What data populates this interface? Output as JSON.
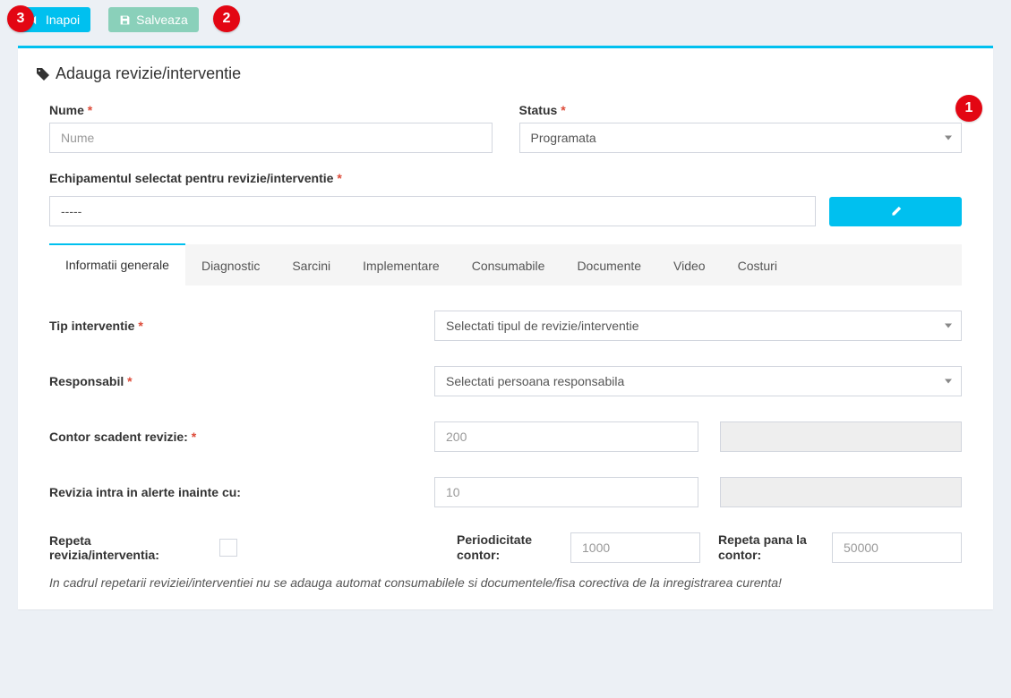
{
  "toolbar": {
    "back_label": "Inapoi",
    "save_label": "Salveaza"
  },
  "panel": {
    "title": "Adauga revizie/interventie"
  },
  "fields": {
    "name_label": "Nume",
    "name_placeholder": "Nume",
    "status_label": "Status",
    "status_value": "Programata",
    "equipment_label": "Echipamentul selectat pentru revizie/interventie",
    "equipment_value": "-----"
  },
  "tabs": [
    "Informatii generale",
    "Diagnostic",
    "Sarcini",
    "Implementare",
    "Consumabile",
    "Documente",
    "Video",
    "Costuri"
  ],
  "general": {
    "type_label": "Tip interventie",
    "type_placeholder": "Selectati tipul de revizie/interventie",
    "responsible_label": "Responsabil",
    "responsible_placeholder": "Selectati persoana responsabila",
    "counter_due_label": "Contor scadent revizie:",
    "counter_due_placeholder": "200",
    "alert_before_label": "Revizia intra in alerte inainte cu:",
    "alert_before_placeholder": "10",
    "repeat_label": "Repeta revizia/interventia:",
    "periodicity_label": "Periodicitate contor:",
    "periodicity_placeholder": "1000",
    "repeat_until_label": "Repeta pana la contor:",
    "repeat_until_placeholder": "50000",
    "note": "In cadrul repetarii reviziei/interventiei nu se adauga automat consumabilele si documentele/fisa corectiva de la inregistrarea curenta!"
  },
  "badges": {
    "b1": "1",
    "b2": "2",
    "b3": "3"
  }
}
